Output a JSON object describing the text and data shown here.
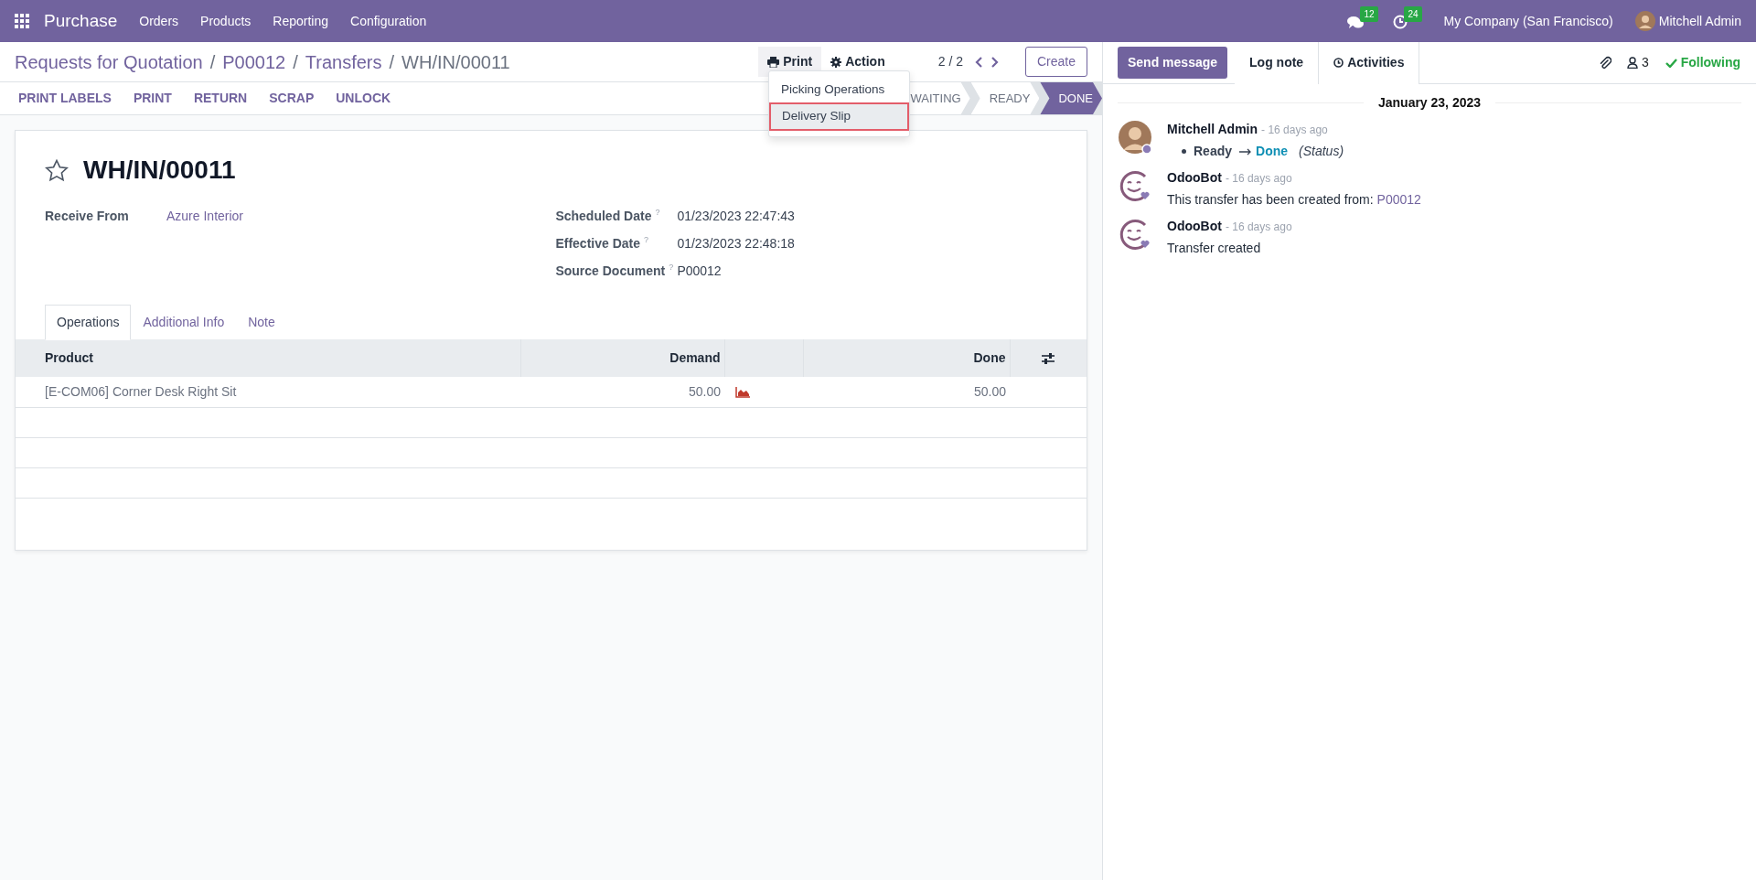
{
  "navbar": {
    "app": "Purchase",
    "menus": [
      "Orders",
      "Products",
      "Reporting",
      "Configuration"
    ],
    "messages_count": "12",
    "activities_count": "24",
    "company": "My Company (San Francisco)",
    "user": "Mitchell Admin"
  },
  "breadcrumbs": [
    {
      "label": "Requests for Quotation",
      "current": false
    },
    {
      "separator": "/",
      "label": "P00012",
      "current": false
    },
    {
      "separator": "/",
      "label": "Transfers",
      "current": false
    },
    {
      "separator": "/",
      "label": "WH/IN/00011",
      "current": true
    }
  ],
  "toolbar": {
    "print": "Print",
    "action": "Action",
    "pager": "2 / 2",
    "create": "Create"
  },
  "print_menu": [
    {
      "label": "Picking Operations",
      "selected": false
    },
    {
      "label": "Delivery Slip",
      "selected": true
    }
  ],
  "action_buttons": [
    "PRINT LABELS",
    "PRINT",
    "RETURN",
    "SCRAP",
    "UNLOCK"
  ],
  "stages": [
    {
      "label": "WAITING",
      "selected": false
    },
    {
      "label": "READY",
      "selected": false
    },
    {
      "label": "DONE",
      "selected": true
    }
  ],
  "record": {
    "starred": false,
    "title": "WH/IN/00011",
    "left_fields": [
      {
        "label": "Receive From",
        "value": "Azure Interior",
        "kind": "link"
      }
    ],
    "right_fields": [
      {
        "label": "Scheduled Date",
        "help": "?",
        "value": "01/23/2023 22:47:43"
      },
      {
        "label": "Effective Date",
        "help": "?",
        "value": "01/23/2023 22:48:18"
      },
      {
        "label": "Source Document",
        "help": "?",
        "value": "P00012"
      }
    ]
  },
  "tabs": [
    {
      "label": "Operations",
      "selected": true
    },
    {
      "label": "Additional Info",
      "selected": false
    },
    {
      "label": "Note",
      "selected": false
    }
  ],
  "table": {
    "columns": [
      "Product",
      "Demand",
      "Done"
    ],
    "rows": [
      {
        "product": "[E-COM06] Corner Desk Right Sit",
        "demand": "50.00",
        "done": "50.00"
      }
    ]
  },
  "chatter": {
    "send_message": "Send message",
    "log_note": "Log note",
    "activities": "Activities",
    "followers": "3",
    "following": "Following",
    "date": "January 23, 2023",
    "messages": [
      {
        "author": "Mitchell Admin",
        "kind": "user",
        "time": "- 16 days ago",
        "change_from": "Ready",
        "change_to": "Done",
        "field": "(Status)"
      },
      {
        "author": "OdooBot",
        "kind": "bot",
        "time": "- 16 days ago",
        "text": "This transfer has been created from:",
        "link": "P00012"
      },
      {
        "author": "OdooBot",
        "kind": "bot",
        "time": "- 16 days ago",
        "text": "Transfer created"
      }
    ]
  }
}
